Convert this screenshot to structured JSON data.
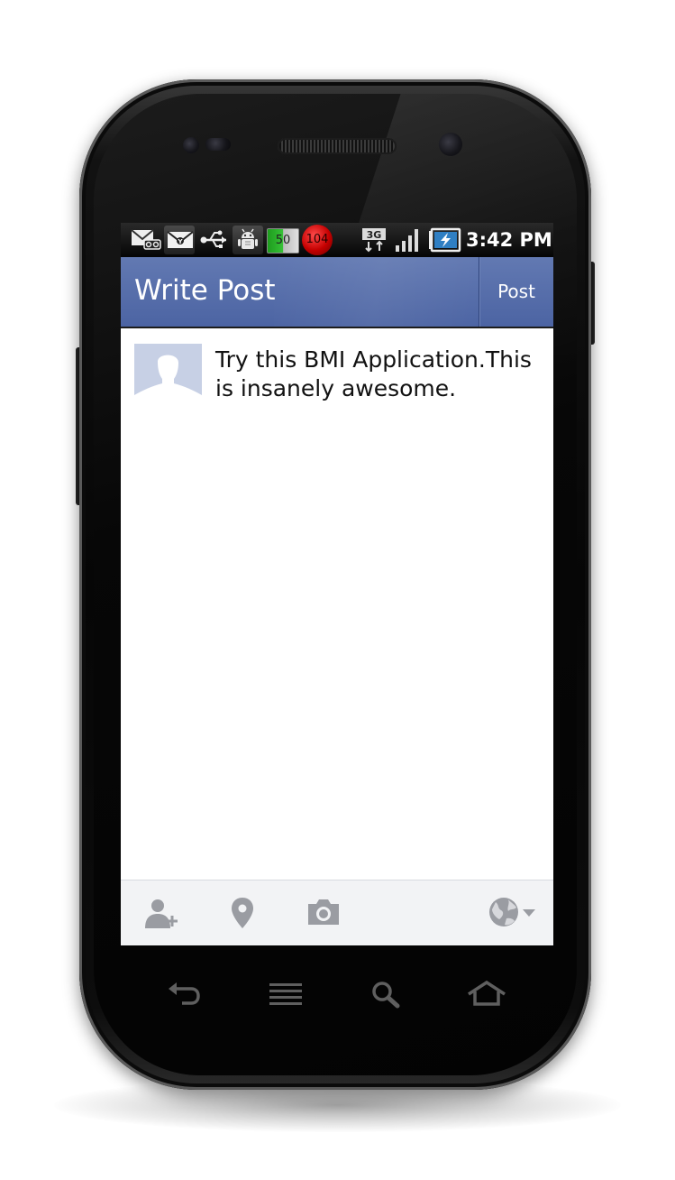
{
  "status_bar": {
    "battery_indicator": "50",
    "cpu_indicator": "104",
    "network_type": "3G",
    "time": "3:42 PM",
    "icons": [
      "voicemail-icon",
      "email-icon",
      "usb-icon",
      "android-debug-icon",
      "battery-percent-icon",
      "cpu-load-icon",
      "3g-data-icon",
      "signal-icon",
      "battery-charging-icon"
    ]
  },
  "action_bar": {
    "title": "Write Post",
    "post_label": "Post",
    "color": "#5169a9"
  },
  "composer": {
    "text": "Try this BMI Application.This is insanely awesome."
  },
  "toolbar": {
    "icons": [
      "add-friend-icon",
      "location-pin-icon",
      "camera-icon",
      "privacy-globe-icon"
    ]
  },
  "nav_buttons": [
    "back-icon",
    "menu-icon",
    "search-icon",
    "home-icon"
  ]
}
